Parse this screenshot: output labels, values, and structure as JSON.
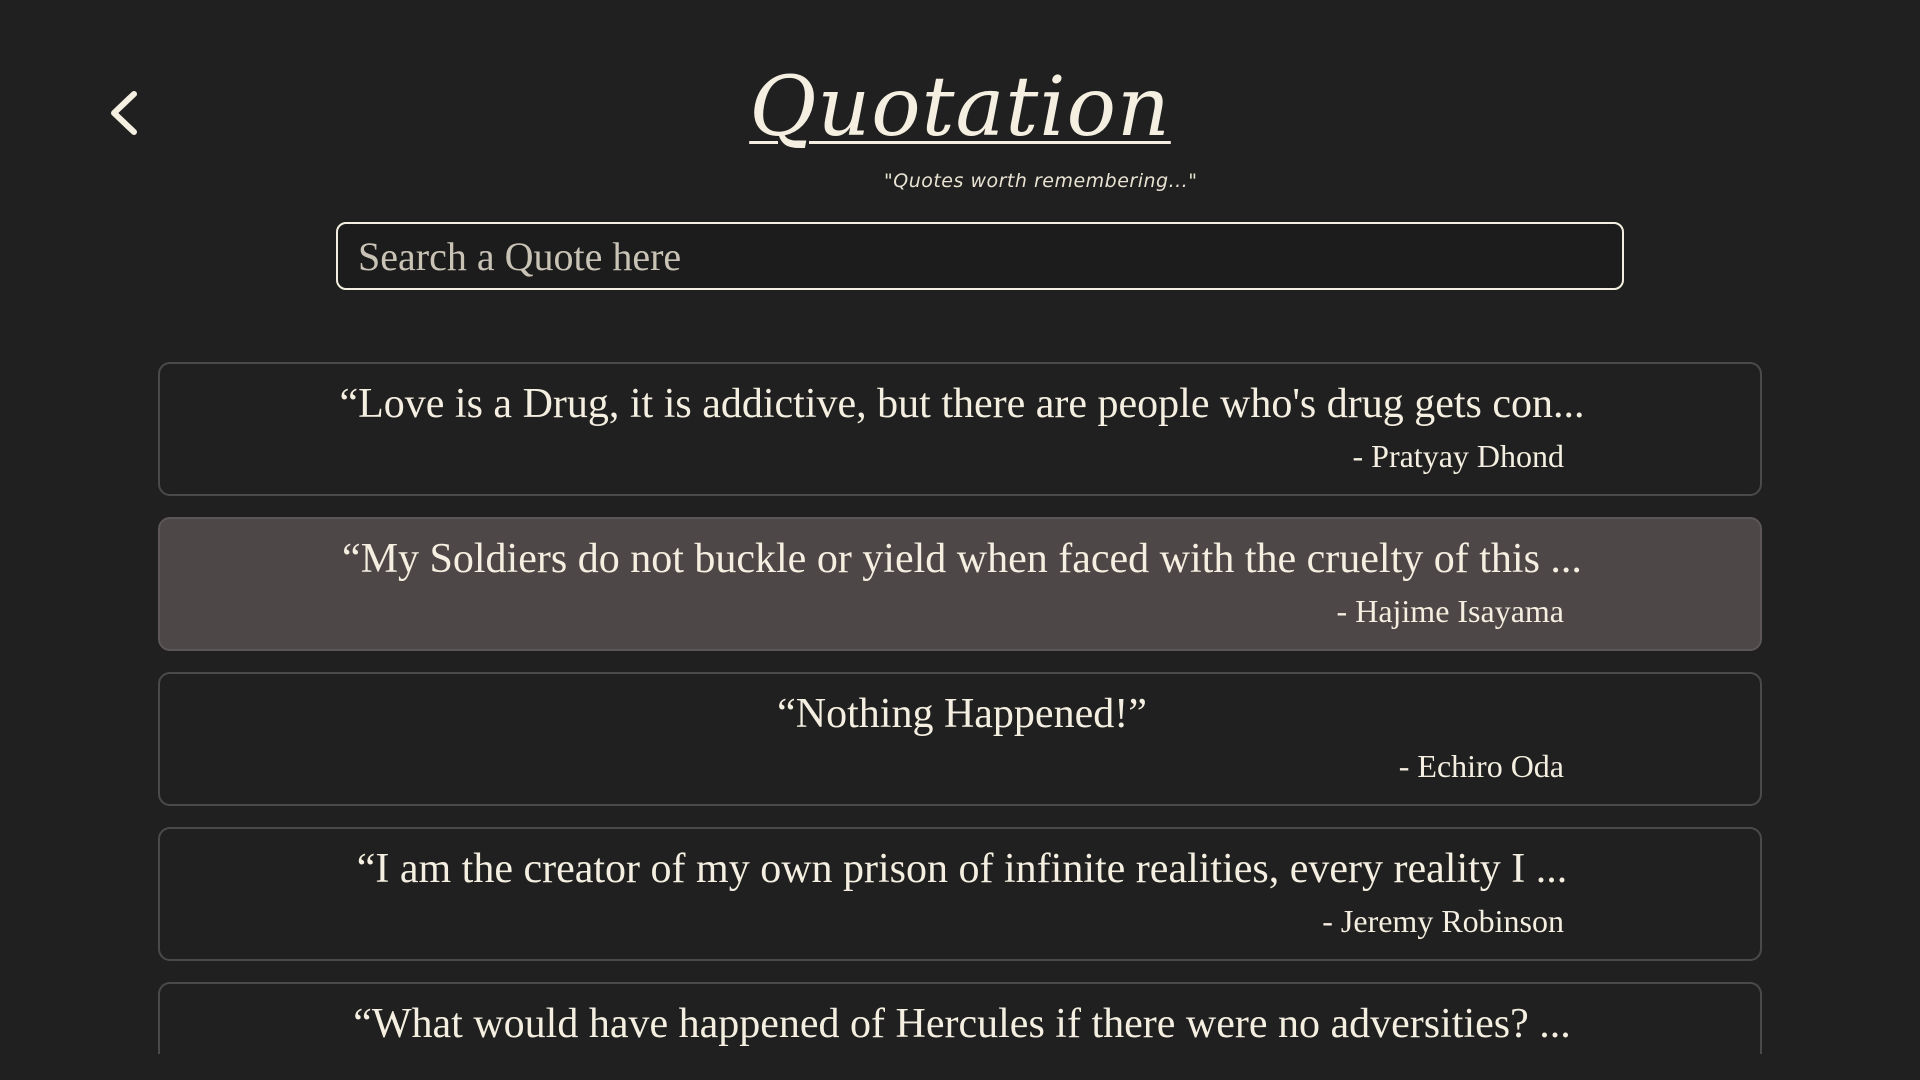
{
  "header": {
    "title": "Quotation",
    "tagline": "\"Quotes worth remembering...\""
  },
  "search": {
    "placeholder": "Search a Quote here",
    "value": ""
  },
  "quotes": [
    {
      "text": "“Love is a Drug, it is addictive, but there are people who's drug gets con...",
      "author": "- Pratyay Dhond",
      "active": false
    },
    {
      "text": "“My Soldiers do not buckle or yield when faced with the cruelty of this ...",
      "author": "- Hajime Isayama",
      "active": true
    },
    {
      "text": "“Nothing Happened!”",
      "author": "- Echiro Oda",
      "active": false
    },
    {
      "text": "“I am the creator of my own prison of infinite realities, every reality I ...",
      "author": "- Jeremy Robinson",
      "active": false
    },
    {
      "text": "“What would have happened of Hercules if there were no adversities? ...",
      "author": "",
      "active": false
    }
  ],
  "icons": {
    "back": "chevron-left-icon"
  },
  "colors": {
    "background": "#202020",
    "text": "#f4efe0",
    "card_border": "#4a4a4a",
    "card_active": "#4d4847"
  }
}
